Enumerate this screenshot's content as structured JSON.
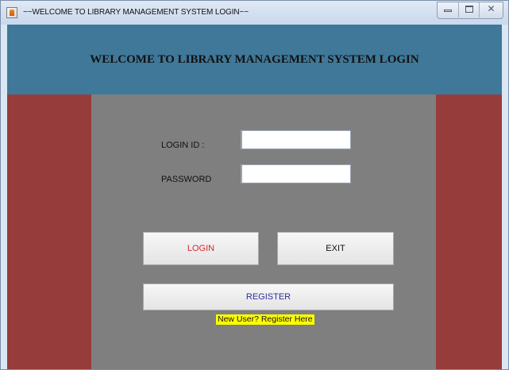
{
  "window": {
    "title": "~~WELCOME TO LIBRARY MANAGEMENT SYSTEM LOGIN~~",
    "controls": [
      "minimize",
      "maximize",
      "close"
    ],
    "close_glyph": "✕"
  },
  "header": {
    "title": "WELCOME TO LIBRARY MANAGEMENT SYSTEM LOGIN"
  },
  "form": {
    "login_id_label": "LOGIN ID :",
    "login_id_value": "",
    "password_label": "PASSWORD",
    "password_value": ""
  },
  "buttons": {
    "login_label": "LOGIN",
    "exit_label": "EXIT",
    "register_label": "REGISTER"
  },
  "register_hint": "New User? Register Here",
  "colors": {
    "header_band": "#3f7899",
    "side_panels": "#963d3b",
    "center_panel": "#7f7f7f",
    "login_text": "#d4262d",
    "register_text": "#2d2fa0",
    "hint_background": "#ffff00"
  },
  "icons": {
    "app": "java-app-icon",
    "minimize": "minimize-icon",
    "maximize": "maximize-icon",
    "close": "close-icon"
  }
}
